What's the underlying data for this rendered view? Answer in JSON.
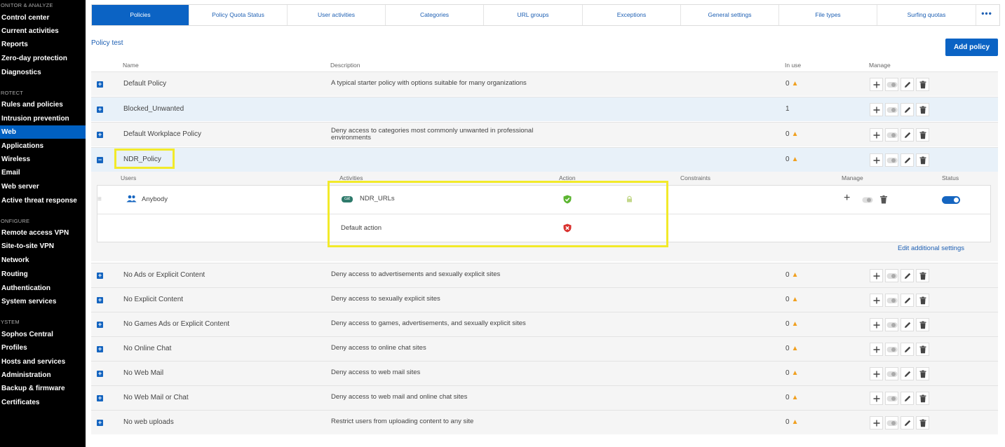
{
  "sidebar": {
    "sections": [
      {
        "label": "ONITOR & ANALYZE",
        "items": [
          "Control center",
          "Current activities",
          "Reports",
          "Zero-day protection",
          "Diagnostics"
        ]
      },
      {
        "label": "ROTECT",
        "items": [
          "Rules and policies",
          "Intrusion prevention",
          "Web",
          "Applications",
          "Wireless",
          "Email",
          "Web server",
          "Active threat response"
        ]
      },
      {
        "label": "ONFIGURE",
        "items": [
          "Remote access VPN",
          "Site-to-site VPN",
          "Network",
          "Routing",
          "Authentication",
          "System services"
        ]
      },
      {
        "label": "YSTEM",
        "items": [
          "Sophos Central",
          "Profiles",
          "Hosts and services",
          "Administration",
          "Backup & firmware",
          "Certificates"
        ]
      }
    ],
    "active_item": "Web"
  },
  "tabs": [
    "Policies",
    "Policy Quota Status",
    "User activities",
    "Categories",
    "URL groups",
    "Exceptions",
    "General settings",
    "File types",
    "Surfing quotas"
  ],
  "tabs_more": "•••",
  "policy_test_link": "Policy test",
  "add_policy_button": "Add policy",
  "columns": {
    "name": "Name",
    "description": "Description",
    "in_use": "In use",
    "manage": "Manage"
  },
  "policies": [
    {
      "name": "Default Policy",
      "description": "A typical starter policy with options suitable for many organizations",
      "in_use": "0",
      "warning": true
    },
    {
      "name": "Blocked_Unwanted",
      "description": "",
      "in_use": "1",
      "warning": false
    },
    {
      "name": "Default Workplace Policy",
      "description": "Deny access to categories most commonly unwanted in professional environments",
      "in_use": "0",
      "warning": true
    },
    {
      "name": "NDR_Policy",
      "description": "",
      "in_use": "0",
      "warning": true,
      "expanded": true
    },
    {
      "name": "No Ads or Explicit Content",
      "description": "Deny access to advertisements and sexually explicit sites",
      "in_use": "0",
      "warning": true
    },
    {
      "name": "No Explicit Content",
      "description": "Deny access to sexually explicit sites",
      "in_use": "0",
      "warning": true
    },
    {
      "name": "No Games Ads or Explicit Content",
      "description": "Deny access to games, advertisements, and sexually explicit sites",
      "in_use": "0",
      "warning": true
    },
    {
      "name": "No Online Chat",
      "description": "Deny access to online chat sites",
      "in_use": "0",
      "warning": true
    },
    {
      "name": "No Web Mail",
      "description": "Deny access to web mail sites",
      "in_use": "0",
      "warning": true
    },
    {
      "name": "No Web Mail or Chat",
      "description": "Deny access to web mail and online chat sites",
      "in_use": "0",
      "warning": true
    },
    {
      "name": "No web uploads",
      "description": "Restrict users from uploading content to any site",
      "in_use": "0",
      "warning": true
    }
  ],
  "expanded_policy": {
    "columns": {
      "users": "Users",
      "activities": "Activities",
      "action": "Action",
      "constraints": "Constraints",
      "manage": "Manage",
      "status": "Status"
    },
    "rule": {
      "users": "Anybody",
      "activity_badge": "cat",
      "activity": "NDR_URLs",
      "action": "allow",
      "status": "on"
    },
    "default_action": {
      "label": "Default action",
      "action": "block"
    },
    "edit_link": "Edit additional settings"
  },
  "colors": {
    "accent": "#0b63c4",
    "highlight": "#f2ea2a",
    "warning": "#f0a020",
    "allow": "#5cb531",
    "block": "#d9322f"
  }
}
